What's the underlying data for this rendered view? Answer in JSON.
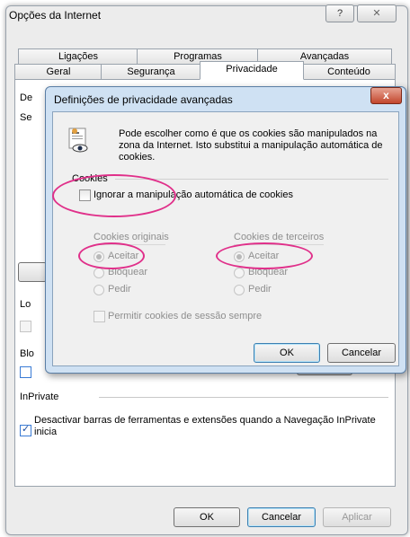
{
  "window": {
    "title": "Opções da Internet",
    "help_label": "?",
    "close_label": "✕"
  },
  "tabs_row1": [
    "Ligações",
    "Programas",
    "Avançadas"
  ],
  "tabs_row2": [
    "Geral",
    "Segurança",
    "Privacidade",
    "Conteúdo"
  ],
  "panel": {
    "cut_labels": [
      "De",
      "Se",
      "Lo",
      "Blo"
    ],
    "inprivate_title": "InPrivate",
    "inprivate_checkbox": "Desactivar barras de ferramentas e extensões quando a Navegação InPrivate inicia"
  },
  "bottom_buttons": {
    "ok": "OK",
    "cancel": "Cancelar",
    "apply": "Aplicar"
  },
  "dialog": {
    "title": "Definições de privacidade avançadas",
    "close_label": "x",
    "description": "Pode escolher como é que os cookies são manipulados na zona da Internet. Isto substitui a manipulação automática de cookies.",
    "cookies_label": "Cookies",
    "override_checkbox": "Ignorar a manipulação automática de cookies",
    "first_party": {
      "title": "Cookies originais",
      "options": [
        "Aceitar",
        "Bloquear",
        "Pedir"
      ]
    },
    "third_party": {
      "title": "Cookies de terceiros",
      "options": [
        "Aceitar",
        "Bloquear",
        "Pedir"
      ]
    },
    "session_checkbox": "Permitir cookies de sessão sempre",
    "ok_label": "OK",
    "cancel_label": "Cancelar"
  }
}
